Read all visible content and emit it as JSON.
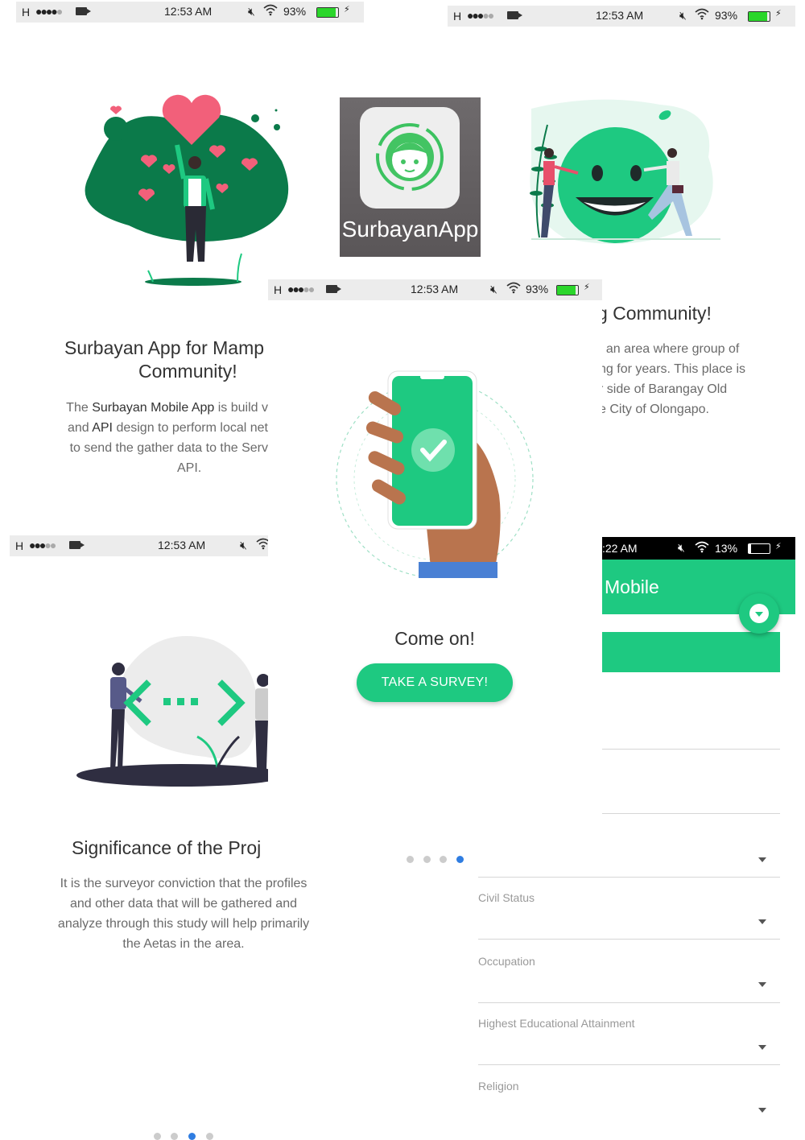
{
  "status_bars": [
    {
      "signal": "H",
      "time": "12:53 AM",
      "battery": "93%"
    },
    {
      "signal": "H",
      "time": "12:53 AM",
      "battery": "93%"
    },
    {
      "signal": "H",
      "time": "12:53 AM",
      "battery": "93%"
    },
    {
      "signal": "H",
      "time": "12:53 AM"
    },
    {
      "time": ":22 AM",
      "battery": "13%"
    }
  ],
  "app_icon": {
    "label": "SurbayanApp"
  },
  "slide1": {
    "title_line1": "Surbayan App for Mamp",
    "title_line2": "Community!",
    "p1_a": "The ",
    "p1_b": "Surbayan Mobile App",
    "p1_c": " is build v",
    "p2_a": "and ",
    "p2_b": "API",
    "p2_c": " design to perform local net",
    "p3": "to send the gather data to the Serv",
    "p4": "API."
  },
  "slide2": {
    "title": "g Community!",
    "lines": [
      ", an area where group of",
      "ng for years. This place is",
      "r side of Barangay Old",
      "e City of Olongapo."
    ]
  },
  "slide3": {
    "title": "Significance of the Proj",
    "lines": [
      "It is the surveyor conviction that the profiles",
      "and other data that will be gathered and",
      "analyze through this study will help primarily",
      "the Aetas in the area."
    ]
  },
  "slide4": {
    "title": "Come on!",
    "button": "TAKE A SURVEY!"
  },
  "form": {
    "header_title": "Mobile",
    "fields": [
      {
        "label": "Civil Status"
      },
      {
        "label": "Occupation"
      },
      {
        "label": "Highest Educational Attainment"
      },
      {
        "label": "Religion"
      }
    ]
  },
  "pagination": {
    "total": 4,
    "active_slide4": 4,
    "active_slide3": 3
  },
  "colors": {
    "green": "#1ec981",
    "dark_green": "#0b7a4a",
    "pink": "#f2607a",
    "blue": "#2f7de1"
  }
}
